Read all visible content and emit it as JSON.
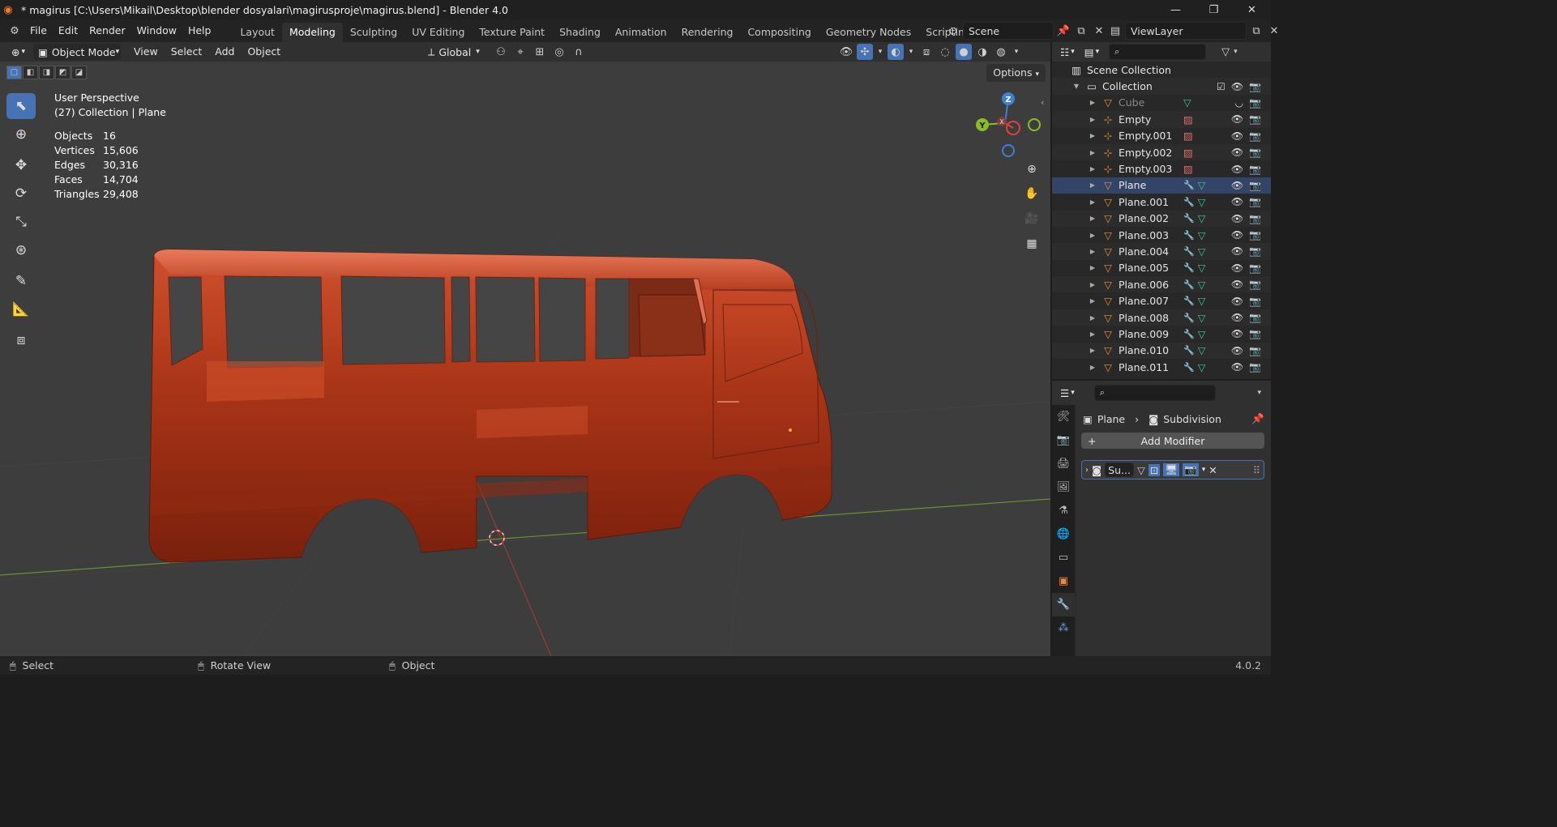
{
  "window": {
    "title": "* magirus [C:\\Users\\Mikail\\Desktop\\blender dosyalari\\magirusproje\\magirus.blend] - Blender 4.0"
  },
  "menu": [
    "File",
    "Edit",
    "Render",
    "Window",
    "Help"
  ],
  "workspaces": [
    {
      "label": "Layout",
      "active": false
    },
    {
      "label": "Modeling",
      "active": true
    },
    {
      "label": "Sculpting",
      "active": false
    },
    {
      "label": "UV Editing",
      "active": false
    },
    {
      "label": "Texture Paint",
      "active": false
    },
    {
      "label": "Shading",
      "active": false
    },
    {
      "label": "Animation",
      "active": false
    },
    {
      "label": "Rendering",
      "active": false
    },
    {
      "label": "Compositing",
      "active": false
    },
    {
      "label": "Geometry Nodes",
      "active": false
    },
    {
      "label": "Scripting",
      "active": false
    }
  ],
  "scene": {
    "name": "Scene"
  },
  "viewlayer": {
    "name": "ViewLayer"
  },
  "viewport_header": {
    "mode": "Object Mode",
    "menus": [
      "View",
      "Select",
      "Add",
      "Object"
    ],
    "orientation": "Global"
  },
  "viewport": {
    "perspective": "User Perspective",
    "collection_info": "(27) Collection | Plane",
    "options_label": "Options",
    "stats": [
      {
        "label": "Objects",
        "value": "16"
      },
      {
        "label": "Vertices",
        "value": "15,606"
      },
      {
        "label": "Edges",
        "value": "30,316"
      },
      {
        "label": "Faces",
        "value": "14,704"
      },
      {
        "label": "Triangles",
        "value": "29,408"
      }
    ],
    "gizmo_labels": {
      "z": "Z",
      "y": "Y",
      "x": "X"
    }
  },
  "outliner": {
    "root": "Scene Collection",
    "collection": "Collection",
    "items": [
      {
        "name": "Cube",
        "type": "mesh",
        "modifier": false,
        "dim": true
      },
      {
        "name": "Empty",
        "type": "empty",
        "modifier": false,
        "dim": false
      },
      {
        "name": "Empty.001",
        "type": "empty",
        "modifier": false,
        "dim": false
      },
      {
        "name": "Empty.002",
        "type": "empty",
        "modifier": false,
        "dim": false
      },
      {
        "name": "Empty.003",
        "type": "empty",
        "modifier": false,
        "dim": false
      },
      {
        "name": "Plane",
        "type": "mesh",
        "modifier": true,
        "dim": false
      },
      {
        "name": "Plane.001",
        "type": "mesh",
        "modifier": true,
        "dim": false
      },
      {
        "name": "Plane.002",
        "type": "mesh",
        "modifier": true,
        "dim": false
      },
      {
        "name": "Plane.003",
        "type": "mesh",
        "modifier": true,
        "dim": false
      },
      {
        "name": "Plane.004",
        "type": "mesh",
        "modifier": true,
        "dim": false
      },
      {
        "name": "Plane.005",
        "type": "mesh",
        "modifier": true,
        "dim": false
      },
      {
        "name": "Plane.006",
        "type": "mesh",
        "modifier": true,
        "dim": false
      },
      {
        "name": "Plane.007",
        "type": "mesh",
        "modifier": true,
        "dim": false
      },
      {
        "name": "Plane.008",
        "type": "mesh",
        "modifier": true,
        "dim": false
      },
      {
        "name": "Plane.009",
        "type": "mesh",
        "modifier": true,
        "dim": false
      },
      {
        "name": "Plane.010",
        "type": "mesh",
        "modifier": true,
        "dim": false
      },
      {
        "name": "Plane.011",
        "type": "mesh",
        "modifier": true,
        "dim": false
      }
    ]
  },
  "properties": {
    "breadcrumb_object": "Plane",
    "breadcrumb_modifier": "Subdivision",
    "add_modifier": "Add Modifier",
    "modifier_short": "Su..."
  },
  "statusbar": {
    "left": "Select",
    "middle": "Rotate View",
    "right": "Object",
    "version": "4.0.2"
  },
  "colors": {
    "accent": "#4772b3",
    "vehicle": "#b4361b",
    "axis_x": "#e0403f",
    "axis_y": "#8bbc27",
    "axis_z": "#3f7fd6"
  }
}
